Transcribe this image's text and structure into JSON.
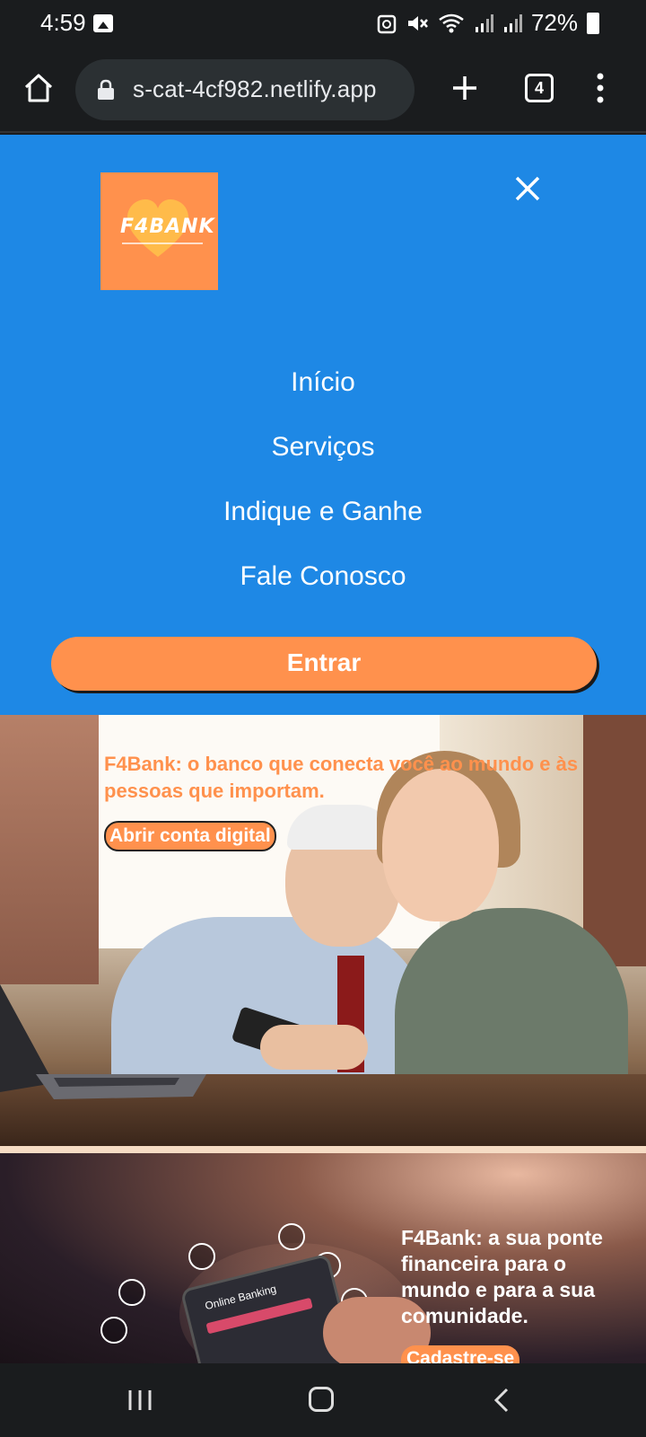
{
  "status_bar": {
    "time": "4:59",
    "battery": "72%",
    "icons": [
      "photo-icon",
      "data-saver-icon",
      "mute-icon",
      "wifi-icon",
      "signal-icon",
      "battery-icon"
    ]
  },
  "browser": {
    "url": "s-cat-4cf982.netlify.app",
    "tab_count": "4"
  },
  "menu": {
    "logo_text": "F4BANK",
    "items": [
      {
        "label": "Início"
      },
      {
        "label": "Serviços"
      },
      {
        "label": "Indique e Ganhe"
      },
      {
        "label": "Fale Conosco"
      }
    ],
    "enter_label": "Entrar"
  },
  "hero_one": {
    "headline": "F4Bank: o banco que conecta você ao mundo e às pessoas que importam.",
    "cta_label": "Abrir conta digital"
  },
  "hero_two": {
    "headline": "F4Bank: a sua ponte financeira para o mundo e para a sua comunidade.",
    "cta_label": "Cadastre-se",
    "phone_screen_label": "Online Banking"
  },
  "colors": {
    "brand_orange": "#ff914d",
    "menu_blue": "#1e88e5",
    "chrome_dark": "#1a1c1e"
  }
}
